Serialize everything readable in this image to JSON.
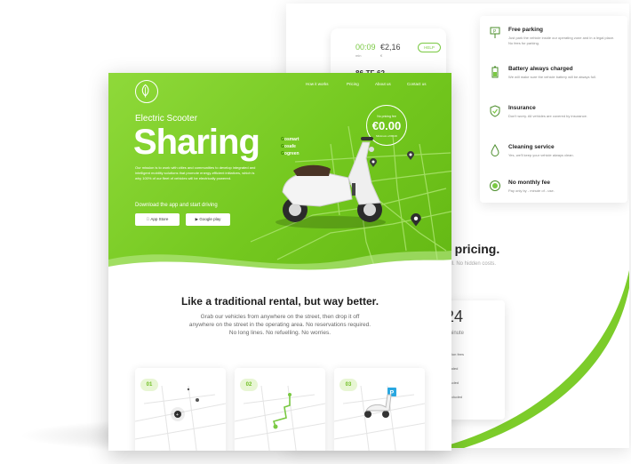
{
  "back_page": {
    "phone_card": {
      "time": "00:09",
      "time_sub": "min",
      "price": "€2,16",
      "price_sub": "€",
      "help": "HELP",
      "plate": "86-TF-62"
    },
    "features": [
      {
        "icon": "parking-sign-icon",
        "title": "Free parking",
        "text": "Just park the vehicle inside our operating zone and in a legal place. No fees for parking."
      },
      {
        "icon": "battery-icon",
        "title": "Battery always charged",
        "text": "We will make sure the vehicle battery will be always full."
      },
      {
        "icon": "shield-check-icon",
        "title": "Insurance",
        "text": "Don't worry. All vehicles are covered by insurance."
      },
      {
        "icon": "water-drop-icon",
        "title": "Cleaning service",
        "text": "Yes, we'll keep your vehicle always clean."
      },
      {
        "icon": "coin-icon",
        "title": "No monthly fee",
        "text": "Pay only by - minute of - use."
      }
    ],
    "pricing_title": "e pricing.",
    "pricing_sub": "all. No hidden costs.",
    "price_card": {
      "value": ",24",
      "unit": "minute",
      "items": [
        "ubscription fees",
        "ing included",
        "city included",
        "rance included"
      ]
    }
  },
  "front_page": {
    "nav": [
      "How it works",
      "Pricing",
      "About us",
      "Contact us"
    ],
    "hero": {
      "kicker": "Electric Scooter",
      "title": "Sharing",
      "tags": [
        {
          "g": "G",
          "rest": "osmart"
        },
        {
          "g": "G",
          "rest": "osafe"
        },
        {
          "g": "G",
          "rest": "ogreen"
        }
      ],
      "description": "Our mission is to work with cities and communities to develop integrated and intelligent mobility solutions that promote energy-efficient initiatives, which is why 100% of our fleet of vehicles will be electrically powered.",
      "download": "Download the app and start driving",
      "app_store": "App Store",
      "google_play": "Google play",
      "badge": {
        "top": "No pricing fee",
        "value": "€0.00",
        "bottom": "Minimum of €0.00"
      }
    },
    "section": {
      "title": "Like a traditional rental, but way better.",
      "description": "Grab our vehicles from anywhere on the street, then drop it off anywhere on the street in the operating area. No reservations required. No long lines. No refuelling. No worries."
    },
    "steps": [
      {
        "num": "01"
      },
      {
        "num": "02"
      },
      {
        "num": "03"
      }
    ]
  },
  "colors": {
    "brand_green": "#74c81f",
    "accent_dark": "#3b8a00"
  }
}
